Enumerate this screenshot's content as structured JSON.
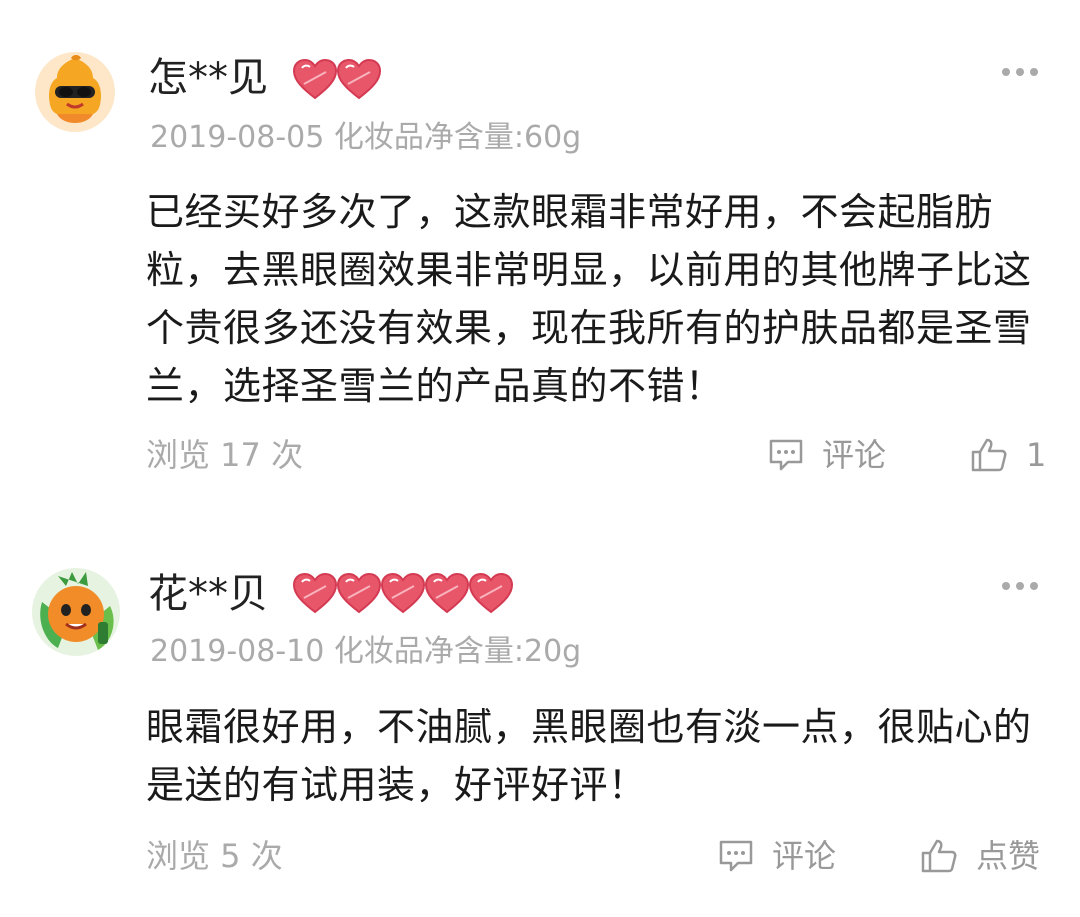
{
  "reviews": [
    {
      "username": "怎**见",
      "hearts": 2,
      "meta": "2019-08-05 化妆品净含量:60g",
      "content": "已经买好多次了，这款眼霜非常好用，不会起脂肪粒，去黑眼圈效果非常明显，以前用的其他牌子比这个贵很多还没有效果，现在我所有的护肤品都是圣雪兰，选择圣雪兰的产品真的不错！",
      "views": "浏览 17 次",
      "comment_label": "评论",
      "like_label": "1"
    },
    {
      "username": "花**贝",
      "hearts": 5,
      "meta": "2019-08-10 化妆品净含量:20g",
      "content": "眼霜很好用，不油腻，黑眼圈也有淡一点，很贴心的是送的有试用装，好评好评！",
      "views": "浏览 5 次",
      "comment_label": "评论",
      "like_label": "点赞"
    }
  ],
  "colors": {
    "text": "#1a1a1a",
    "muted": "#aaaaaa",
    "heart": "#e8566a",
    "avatar_orange": "#f5a623"
  },
  "icons": [
    "more-icon",
    "heart-icon",
    "comment-icon",
    "thumbs-up-icon",
    "avatar-icon"
  ]
}
